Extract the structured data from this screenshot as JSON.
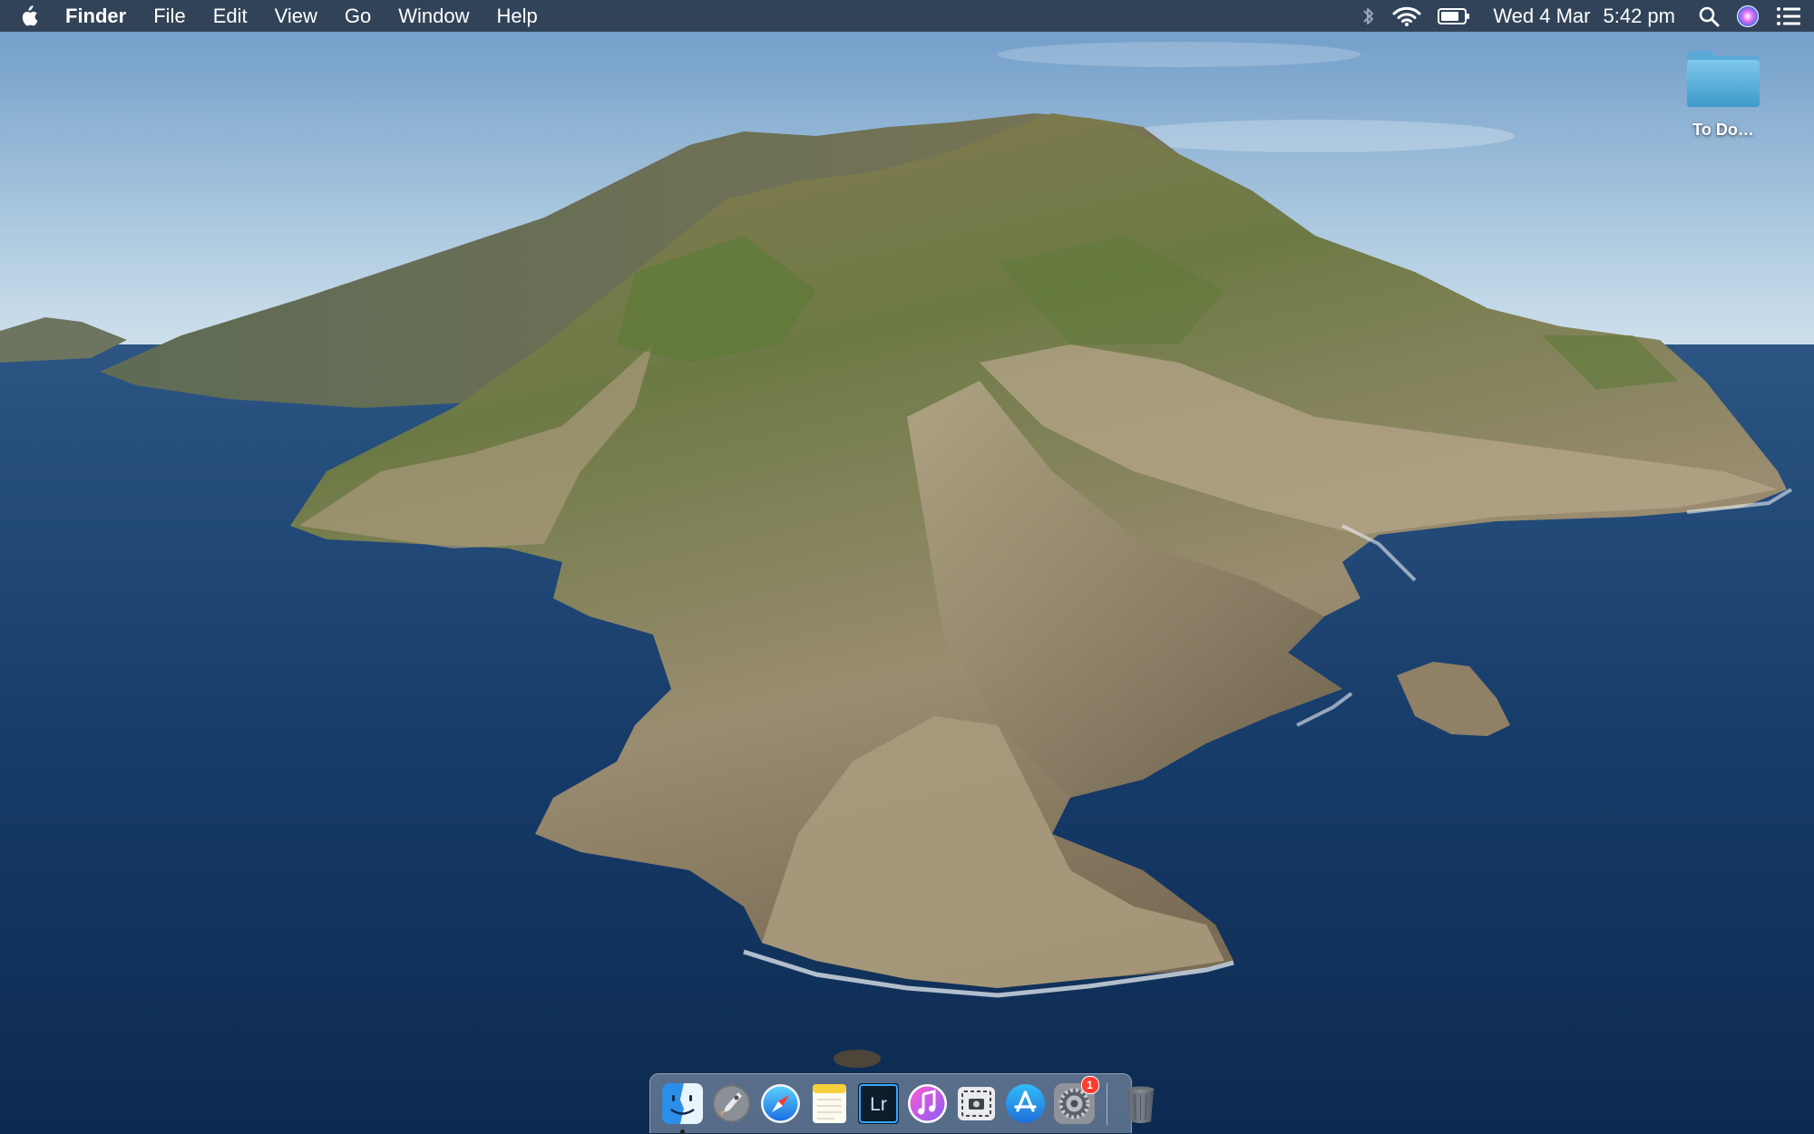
{
  "menubar": {
    "app_name": "Finder",
    "menus": [
      "File",
      "Edit",
      "View",
      "Go",
      "Window",
      "Help"
    ],
    "status_icons": [
      "bluetooth-icon",
      "wifi-icon",
      "battery-icon"
    ],
    "clock": {
      "date": "Wed 4 Mar",
      "time": "5:42 pm"
    },
    "extras": [
      "spotlight-icon",
      "siri-icon",
      "notification-center-icon"
    ]
  },
  "desktop": {
    "icons": [
      {
        "label": "To Do…",
        "kind": "folder-icon"
      }
    ]
  },
  "dock": {
    "apps": [
      {
        "name": "Finder",
        "icon": "finder-icon",
        "running": true
      },
      {
        "name": "Launchpad",
        "icon": "launchpad-icon",
        "running": false
      },
      {
        "name": "Safari",
        "icon": "safari-icon",
        "running": false
      },
      {
        "name": "Notes",
        "icon": "notes-icon",
        "running": false
      },
      {
        "name": "Lightroom",
        "icon": "lightroom-icon",
        "label": "Lr",
        "running": false
      },
      {
        "name": "iTunes",
        "icon": "itunes-icon",
        "running": false
      },
      {
        "name": "Screenshot",
        "icon": "screenshot-icon",
        "running": false
      },
      {
        "name": "App Store",
        "icon": "app-store-icon",
        "running": false
      },
      {
        "name": "System Preferences",
        "icon": "system-preferences-icon",
        "badge": "1",
        "running": false
      }
    ],
    "trash": {
      "name": "Trash",
      "icon": "trash-icon"
    }
  },
  "colors": {
    "menubar": "#283446",
    "badge": "#ff3b30",
    "accent": "#1e6fd9"
  }
}
